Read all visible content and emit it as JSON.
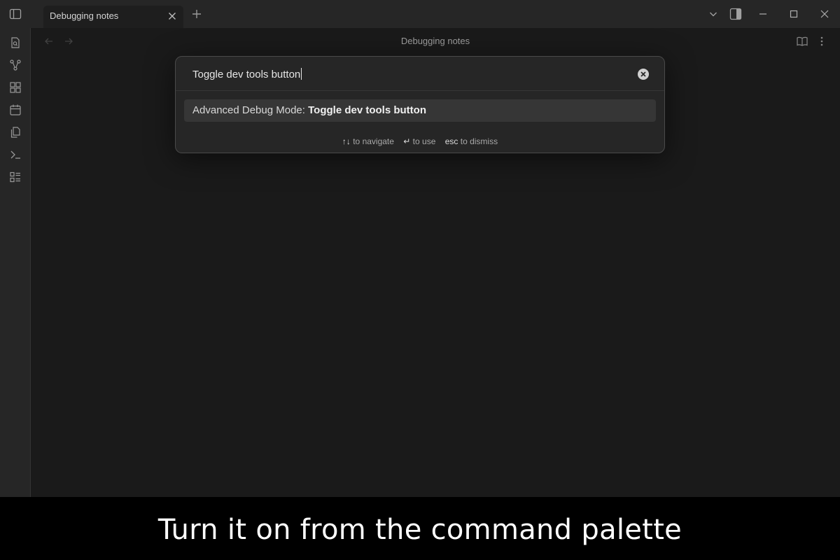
{
  "window": {
    "tab_title": "Debugging notes",
    "controls": [
      "chevron-down-icon",
      "split-panel-icon",
      "minimize-icon",
      "maximize-icon",
      "close-icon"
    ]
  },
  "ribbon": {
    "items": [
      "open-quick-switcher-icon",
      "graph-view-icon",
      "canvas-icon",
      "daily-note-icon",
      "templates-icon",
      "command-palette-icon",
      "bases-icon"
    ]
  },
  "view": {
    "title": "Debugging notes"
  },
  "palette": {
    "query": "Toggle dev tools button",
    "result": {
      "prefix": "Advanced Debug Mode: ",
      "match": "Toggle dev tools button"
    },
    "hints": [
      {
        "key": "↑↓",
        "text": " to navigate"
      },
      {
        "key": "↵",
        "text": " to use"
      },
      {
        "key": "esc",
        "text": " to dismiss"
      }
    ]
  },
  "caption": "Turn it on from the command palette",
  "colors": {
    "background": "#1e1e1e",
    "chrome": "#262626",
    "selected_item": "#363636",
    "caption_band": "#000000"
  }
}
